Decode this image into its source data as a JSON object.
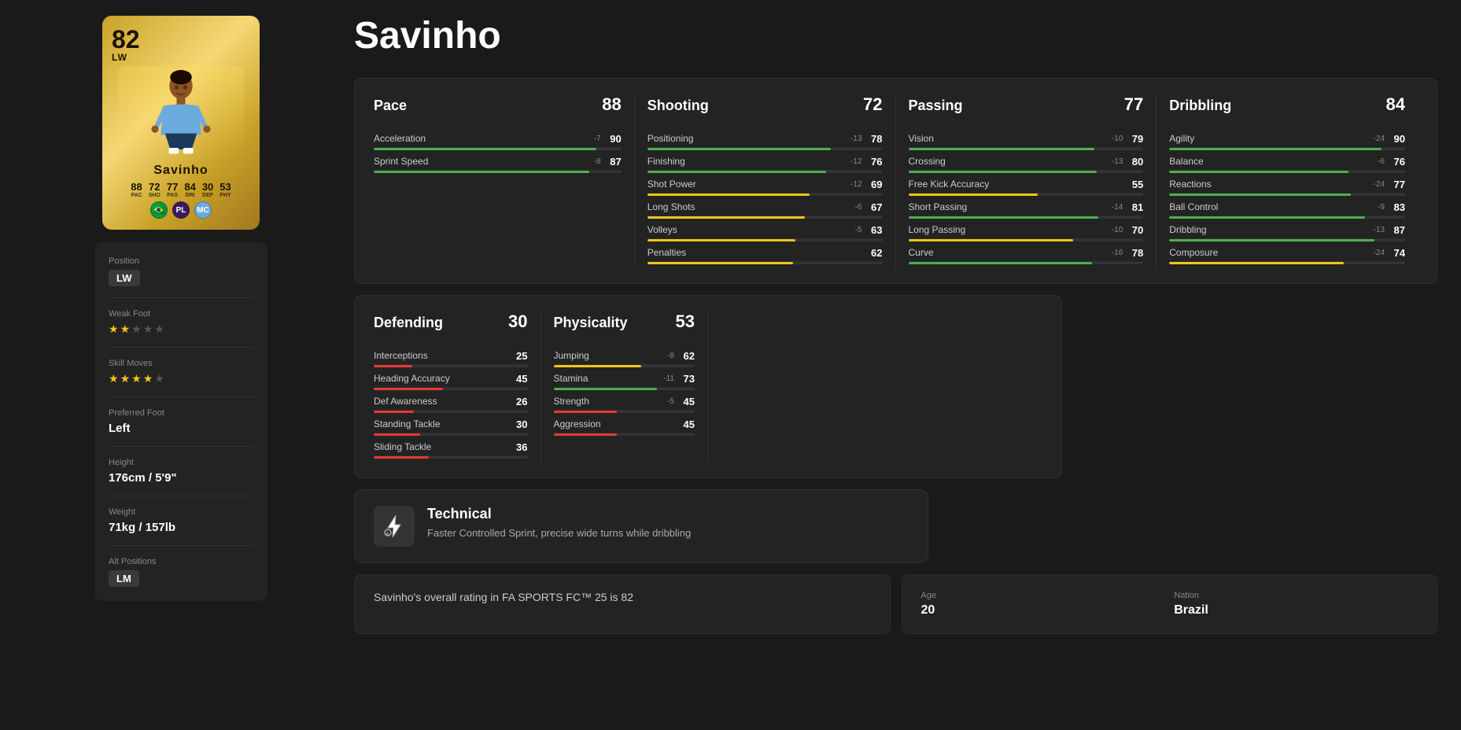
{
  "player": {
    "name": "Savinho",
    "overall": 82,
    "position": "LW",
    "card_stats": {
      "pac": {
        "label": "PAC",
        "value": 88
      },
      "sho": {
        "label": "SHO",
        "value": 72
      },
      "pas": {
        "label": "PAS",
        "value": 77
      },
      "dri": {
        "label": "DRI",
        "value": 84
      },
      "def": {
        "label": "DEF",
        "value": 30
      },
      "phy": {
        "label": "PHY",
        "value": 53
      }
    },
    "info": {
      "position_label": "Position",
      "position": "LW",
      "weak_foot_label": "Weak Foot",
      "weak_foot": 2,
      "skill_moves_label": "Skill Moves",
      "skill_moves": 4,
      "preferred_foot_label": "Preferred Foot",
      "preferred_foot": "Left",
      "height_label": "Height",
      "height": "176cm / 5'9\"",
      "weight_label": "Weight",
      "weight": "71kg / 157lb",
      "alt_positions_label": "Alt Positions",
      "alt_position": "LM"
    }
  },
  "stats": {
    "pace": {
      "name": "Pace",
      "rating": 88,
      "items": [
        {
          "name": "Acceleration",
          "value": 90,
          "diff": "-7",
          "bar": 90
        },
        {
          "name": "Sprint Speed",
          "value": 87,
          "diff": "-8",
          "bar": 87
        }
      ]
    },
    "shooting": {
      "name": "Shooting",
      "rating": 72,
      "items": [
        {
          "name": "Positioning",
          "value": 78,
          "diff": "-13",
          "bar": 78
        },
        {
          "name": "Finishing",
          "value": 76,
          "diff": "-12",
          "bar": 76
        },
        {
          "name": "Shot Power",
          "value": 69,
          "diff": "-12",
          "bar": 69
        },
        {
          "name": "Long Shots",
          "value": 67,
          "diff": "-6",
          "bar": 67
        },
        {
          "name": "Volleys",
          "value": 63,
          "diff": "-5",
          "bar": 63
        },
        {
          "name": "Penalties",
          "value": 62,
          "diff": "",
          "bar": 62
        }
      ]
    },
    "passing": {
      "name": "Passing",
      "rating": 77,
      "items": [
        {
          "name": "Vision",
          "value": 79,
          "diff": "-10",
          "bar": 79
        },
        {
          "name": "Crossing",
          "value": 80,
          "diff": "-13",
          "bar": 80
        },
        {
          "name": "Free Kick Accuracy",
          "value": 55,
          "diff": "",
          "bar": 55
        },
        {
          "name": "Short Passing",
          "value": 81,
          "diff": "-14",
          "bar": 81
        },
        {
          "name": "Long Passing",
          "value": 70,
          "diff": "-10",
          "bar": 70
        },
        {
          "name": "Curve",
          "value": 78,
          "diff": "-16",
          "bar": 78
        }
      ]
    },
    "dribbling": {
      "name": "Dribbling",
      "rating": 84,
      "items": [
        {
          "name": "Agility",
          "value": 90,
          "diff": "-24",
          "bar": 90
        },
        {
          "name": "Balance",
          "value": 76,
          "diff": "-6",
          "bar": 76
        },
        {
          "name": "Reactions",
          "value": 77,
          "diff": "-24",
          "bar": 77
        },
        {
          "name": "Ball Control",
          "value": 83,
          "diff": "-9",
          "bar": 83
        },
        {
          "name": "Dribbling",
          "value": 87,
          "diff": "-13",
          "bar": 87
        },
        {
          "name": "Composure",
          "value": 74,
          "diff": "-24",
          "bar": 74
        }
      ]
    },
    "defending": {
      "name": "Defending",
      "rating": 30,
      "items": [
        {
          "name": "Interceptions",
          "value": 25,
          "diff": "",
          "bar": 25
        },
        {
          "name": "Heading Accuracy",
          "value": 45,
          "diff": "",
          "bar": 45
        },
        {
          "name": "Def Awareness",
          "value": 26,
          "diff": "",
          "bar": 26
        },
        {
          "name": "Standing Tackle",
          "value": 30,
          "diff": "",
          "bar": 30
        },
        {
          "name": "Sliding Tackle",
          "value": 36,
          "diff": "",
          "bar": 36
        }
      ]
    },
    "physicality": {
      "name": "Physicality",
      "rating": 53,
      "items": [
        {
          "name": "Jumping",
          "value": 62,
          "diff": "-8",
          "bar": 62
        },
        {
          "name": "Stamina",
          "value": 73,
          "diff": "-11",
          "bar": 73
        },
        {
          "name": "Strength",
          "value": 45,
          "diff": "-5",
          "bar": 45
        },
        {
          "name": "Aggression",
          "value": 45,
          "diff": "",
          "bar": 45
        }
      ]
    }
  },
  "technical": {
    "title": "Technical",
    "description": "Faster Controlled Sprint, precise wide turns while dribbling"
  },
  "bottom": {
    "overall_text": "Savinho's overall rating in FA SPORTS FC™ 25 is 82",
    "age_label": "Age",
    "age": "20",
    "nation_label": "Nation",
    "nation": "Brazil"
  }
}
